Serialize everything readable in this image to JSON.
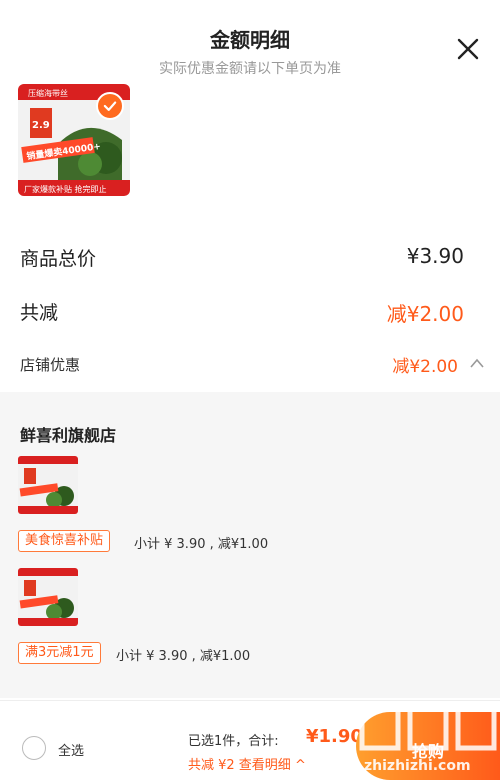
{
  "header": {
    "title": "金额明细",
    "subtitle": "实际优惠金额请以下单页为准"
  },
  "summary": {
    "total_label": "商品总价",
    "total_value": "¥3.90",
    "reduce_label": "共减",
    "reduce_value": "减¥2.00",
    "shop_discount_label": "店铺优惠",
    "shop_discount_value": "减¥2.00"
  },
  "store": {
    "name": "鲜喜利旗舰店",
    "items": [
      {
        "promo": "美食惊喜补贴",
        "subtotal": "小计 ¥ 3.90 , 减¥1.00"
      },
      {
        "promo": "满3元减1元",
        "subtotal": "小计 ¥ 3.90 , 减¥1.00"
      }
    ]
  },
  "product_image_text": {
    "badge": "压缩海带丝",
    "price": "2.9",
    "sales": "销量爆卖40000+",
    "bottom": "厂家爆款补贴 抢完即止"
  },
  "bottom_bar": {
    "select_all": "全选",
    "selected": "已选1件，合计:",
    "total": "¥1.90",
    "saving": "共减 ¥2  查看明细 ^",
    "buy": "抢购"
  },
  "watermark": "zhizhizhi.com",
  "colors": {
    "accent": "#ff5a1a",
    "panel": "#f6f6f6"
  }
}
